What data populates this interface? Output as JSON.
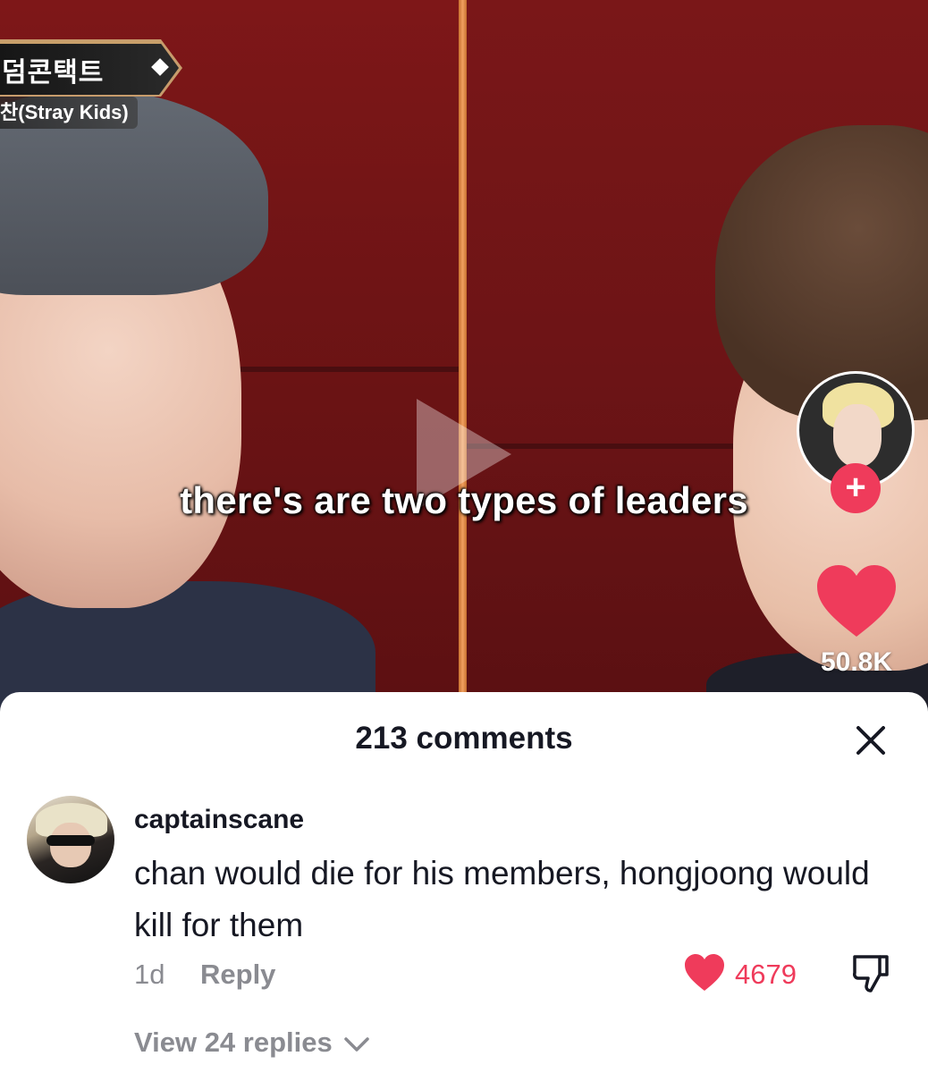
{
  "video": {
    "show_title": "덤콘택트",
    "show_subtitle": "찬(Stray Kids)",
    "caption": "there's are two types of leaders",
    "like_count": "50.8K",
    "follow_symbol": "+"
  },
  "comments_sheet": {
    "title": "213 comments",
    "comment": {
      "username": "captainscane",
      "text": "chan would die for his members, hongjoong would kill for them",
      "age": "1d",
      "reply_label": "Reply",
      "like_count": "4679",
      "view_replies_label": "View 24 replies"
    }
  },
  "colors": {
    "accent": "#ef3b5b",
    "muted_text": "#8a8b91",
    "primary_text": "#161823"
  },
  "icons": [
    "play-icon",
    "heart-icon",
    "plus-icon",
    "close-icon",
    "dislike-icon",
    "chevron-down-icon"
  ]
}
